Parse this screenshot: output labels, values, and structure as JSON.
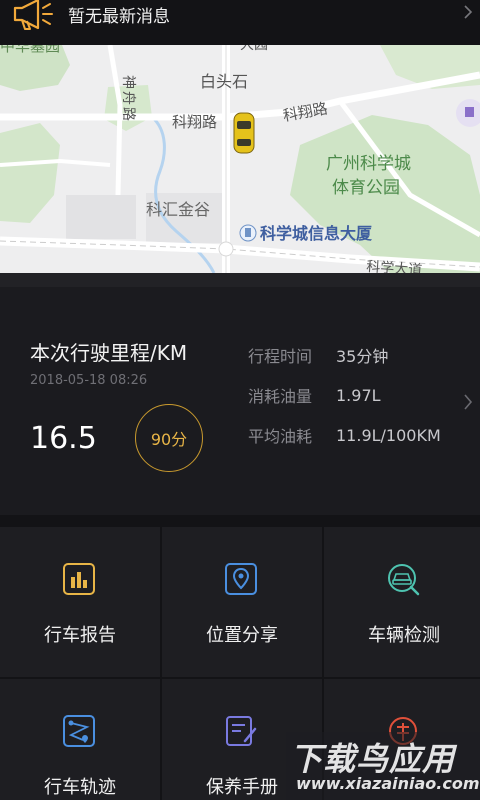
{
  "notice": {
    "text": "暂无最新消息",
    "icon": "megaphone-icon",
    "accent": "#f2a93b"
  },
  "map": {
    "labels": {
      "top_partial": "中华墓园",
      "top_mid": "大园",
      "shenzhou": "神舟路",
      "baitoushi": "白头石",
      "kexiang_left": "科翔路",
      "kexiang_right": "科翔路",
      "park_line1": "广州科学城",
      "park_line2": "体育公园",
      "kehui": "科汇金谷",
      "info_building": "科学城信息大厦",
      "kexue_road": "科学大道"
    }
  },
  "trip": {
    "title": "本次行驶里程/KM",
    "date": "2018-05-18 08:26",
    "distance": "16.5",
    "score": "90分",
    "stats": [
      {
        "label": "行程时间",
        "value": "35分钟"
      },
      {
        "label": "消耗油量",
        "value": "1.97L"
      },
      {
        "label": "平均油耗",
        "value": "11.9L/100KM"
      }
    ],
    "accent": "#c99a2e"
  },
  "grid": {
    "items": [
      {
        "label": "行车报告",
        "icon": "bar-chart-icon",
        "color": "#e8b547"
      },
      {
        "label": "位置分享",
        "icon": "location-pin-icon",
        "color": "#4a8fe0"
      },
      {
        "label": "车辆检测",
        "icon": "car-inspection-icon",
        "color": "#4ec3b0"
      },
      {
        "label": "行车轨迹",
        "icon": "route-icon",
        "color": "#4a8fe0"
      },
      {
        "label": "保养手册",
        "icon": "manual-edit-icon",
        "color": "#7a7ae0"
      },
      {
        "label": "",
        "icon": "red-badge-icon",
        "color": "#e0503a"
      }
    ]
  },
  "watermark": {
    "line1": "下载鸟应用",
    "line2": "www.xiazainiao.com"
  }
}
